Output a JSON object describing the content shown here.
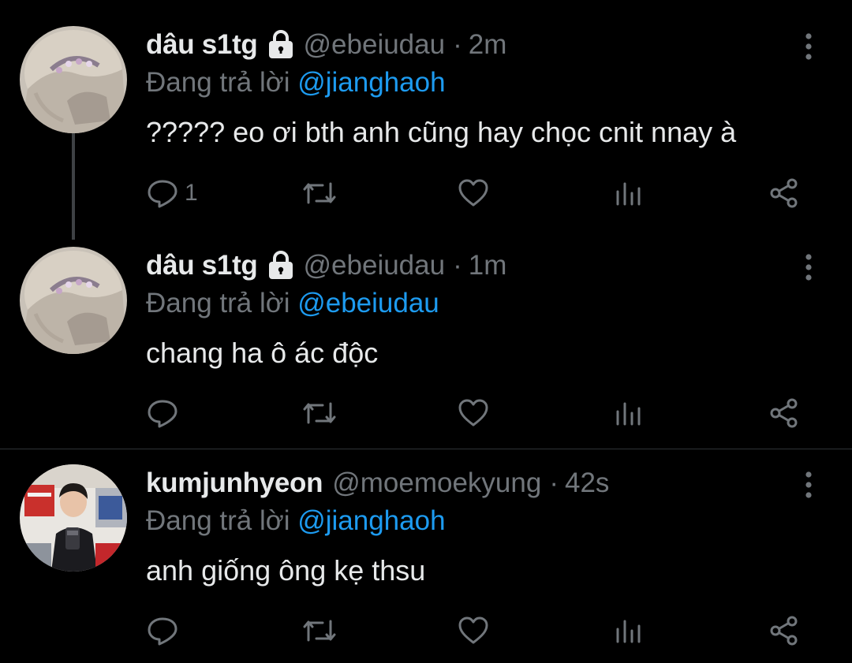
{
  "theme": {
    "background": "#000000",
    "text_primary": "#e7e9ea",
    "text_secondary": "#71767b",
    "accent": "#1d9bf0",
    "divider": "#2f3336"
  },
  "tweets": [
    {
      "display_name": "dâu s1tg",
      "protected": true,
      "handle": "@ebeiudau",
      "separator": "·",
      "time": "2m",
      "reply_prefix": "Đang trả lời ",
      "reply_to": "@jianghaoh",
      "text": "????? eo ơi bth anh cũng hay chọc cnit nnay à",
      "reply_count": "1",
      "avatar_icon": "avatar-hair-tiara"
    },
    {
      "display_name": "dâu s1tg",
      "protected": true,
      "handle": "@ebeiudau",
      "separator": "·",
      "time": "1m",
      "reply_prefix": "Đang trả lời ",
      "reply_to": "@ebeiudau",
      "text": "chang ha ô ác độc",
      "reply_count": "",
      "avatar_icon": "avatar-hair-tiara"
    },
    {
      "display_name": "kumjunhyeon",
      "protected": false,
      "handle": "@moemoekyung",
      "separator": "·",
      "time": "42s",
      "reply_prefix": "Đang trả lời ",
      "reply_to": "@jianghaoh",
      "text": "anh giống ông kẹ thsu",
      "reply_count": "",
      "avatar_icon": "avatar-mirror-selfie"
    }
  ],
  "action_icons": [
    "reply-icon",
    "retweet-icon",
    "like-icon",
    "views-icon",
    "share-icon"
  ]
}
